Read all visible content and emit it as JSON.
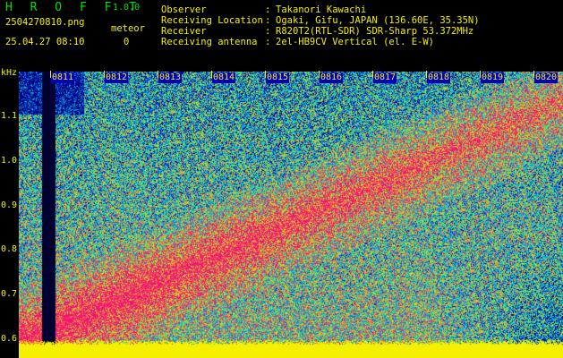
{
  "app": {
    "name": "H R O F F T",
    "version": "1.0.0"
  },
  "file": {
    "name": "2504270810.png",
    "datetime": "25.04.27 08:10"
  },
  "meteor": {
    "label": "meteor",
    "count": "0"
  },
  "info": [
    {
      "label": "Observer",
      "value": "Takanori Kawachi"
    },
    {
      "label": "Receiving Location",
      "value": "Ogaki, Gifu, JAPAN (136.60E, 35.35N)"
    },
    {
      "label": "Receiver",
      "value": "R820T2(RTL-SDR) SDR-Sharp 53.372MHz"
    },
    {
      "label": "Receiving antenna",
      "value": "2el-HB9CV Vertical (el. E-W)"
    }
  ],
  "axis": {
    "y_unit": "kHz",
    "y_ticks": [
      "1.1",
      "1.0",
      "0.9",
      "0.8",
      "0.7",
      "0.6"
    ],
    "x_ticks": [
      "0811",
      "0812",
      "0813",
      "0814",
      "0815",
      "0816",
      "0817",
      "0818",
      "0819",
      "0820"
    ]
  },
  "colors": {
    "text": "#f4f000",
    "title": "#00e000",
    "background": "#000000",
    "noise_floor": "#f4f000"
  }
}
